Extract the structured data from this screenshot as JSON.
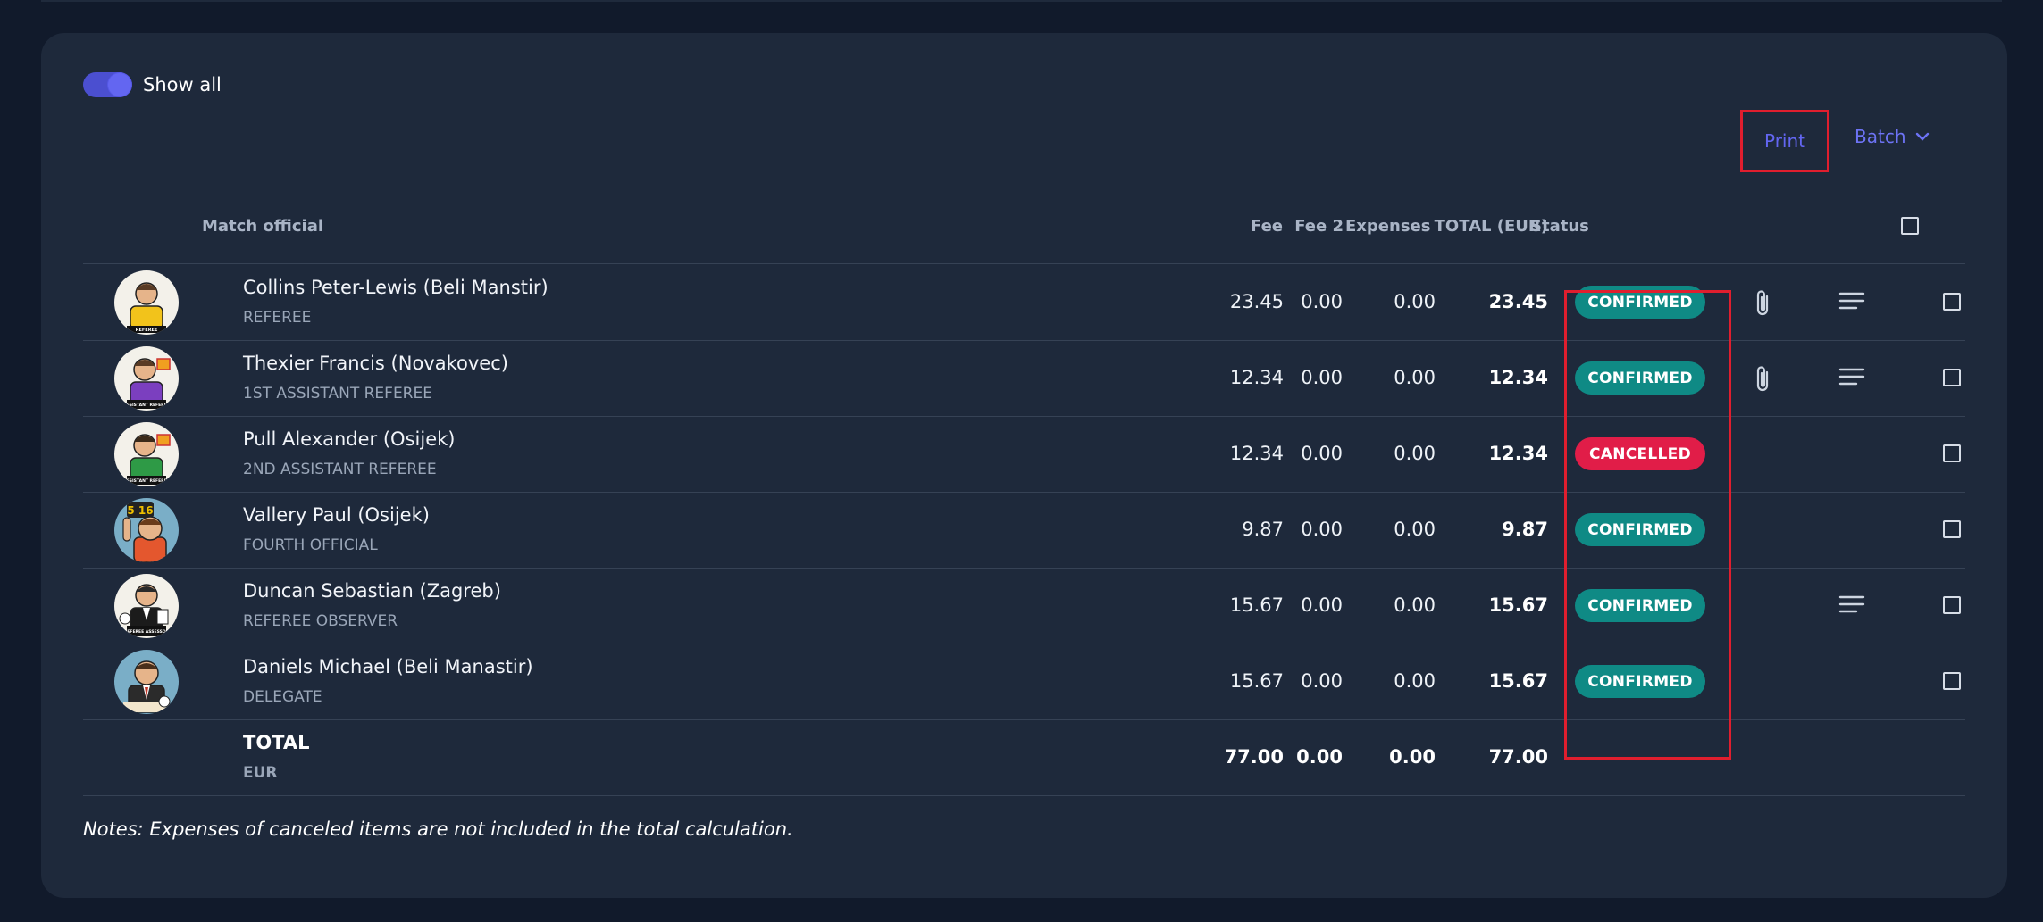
{
  "toggle": {
    "label": "Show all",
    "on": true
  },
  "toolbar": {
    "print_label": "Print",
    "batch_label": "Batch"
  },
  "table": {
    "headers": {
      "official": "Match official",
      "fee": "Fee",
      "fee2": "Fee 2",
      "expenses": "Expenses",
      "total": "TOTAL (EUR)",
      "status": "Status"
    },
    "rows": [
      {
        "name": "Collins Peter-Lewis (Beli Manstir)",
        "role": "REFEREE",
        "fee": "23.45",
        "fee2": "0.00",
        "expenses": "0.00",
        "total": "23.45",
        "status": "CONFIRMED",
        "avatar_label": "REFEREE"
      },
      {
        "name": "Thexier Francis (Novakovec)",
        "role": "1ST ASSISTANT REFEREE",
        "fee": "12.34",
        "fee2": "0.00",
        "expenses": "0.00",
        "total": "12.34",
        "status": "CONFIRMED",
        "avatar_label": "ASSISTANT REFEREE"
      },
      {
        "name": "Pull Alexander (Osijek)",
        "role": "2ND ASSISTANT REFEREE",
        "fee": "12.34",
        "fee2": "0.00",
        "expenses": "0.00",
        "total": "12.34",
        "status": "CANCELLED",
        "avatar_label": "ASSISTANT REFEREE"
      },
      {
        "name": "Vallery Paul (Osijek)",
        "role": "FOURTH OFFICIAL",
        "fee": "9.87",
        "fee2": "0.00",
        "expenses": "0.00",
        "total": "9.87",
        "status": "CONFIRMED",
        "avatar_label": "5 16"
      },
      {
        "name": "Duncan Sebastian (Zagreb)",
        "role": "REFEREE OBSERVER",
        "fee": "15.67",
        "fee2": "0.00",
        "expenses": "0.00",
        "total": "15.67",
        "status": "CONFIRMED",
        "avatar_label": "REFEREE ASSESSOR"
      },
      {
        "name": "Daniels Michael (Beli Manastir)",
        "role": "DELEGATE",
        "fee": "15.67",
        "fee2": "0.00",
        "expenses": "0.00",
        "total": "15.67",
        "status": "CONFIRMED",
        "avatar_label": ""
      }
    ],
    "totals": {
      "label": "TOTAL",
      "currency": "EUR",
      "fee": "77.00",
      "fee2": "0.00",
      "expenses": "0.00",
      "total": "77.00"
    }
  },
  "notes": "Notes: Expenses of canceled items are not included in the total calculation.",
  "colors": {
    "accent": "#6366f1",
    "confirmed": "#0f8a85",
    "cancelled": "#e11d48",
    "highlight": "#e01e2e"
  }
}
